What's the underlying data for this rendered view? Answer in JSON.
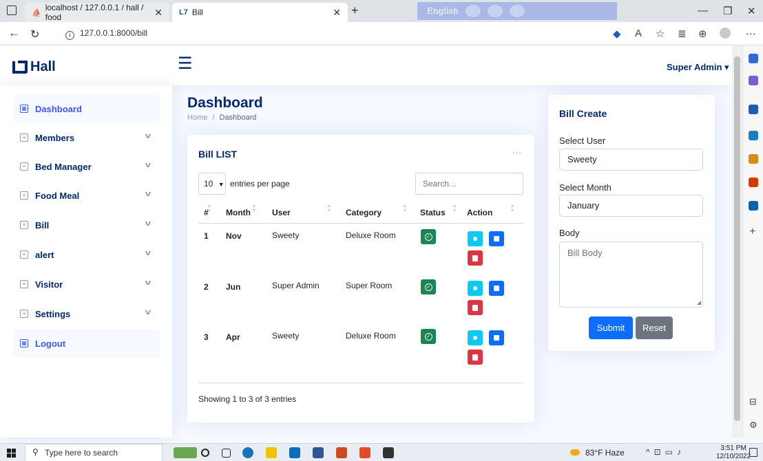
{
  "browser": {
    "tabs": [
      {
        "title": "localhost / 127.0.0.1 / hall / food"
      },
      {
        "title": "Bill"
      }
    ],
    "translate_language": "English",
    "url": "127.0.0.1:8000/bill"
  },
  "app": {
    "brand": "Hall",
    "user_menu": "Super Admin ▾"
  },
  "sidebar": {
    "items": [
      {
        "label": "Dashboard"
      },
      {
        "label": "Members"
      },
      {
        "label": "Bed Manager"
      },
      {
        "label": "Food Meal"
      },
      {
        "label": "Bill"
      },
      {
        "label": "alert"
      },
      {
        "label": "Visitor"
      },
      {
        "label": "Settings"
      },
      {
        "label": "Logout"
      }
    ]
  },
  "page": {
    "title": "Dashboard",
    "breadcrumb": [
      "Home",
      "Dashboard"
    ],
    "breadcrumb_sep": "/"
  },
  "bill_list": {
    "title": "Bill LIST",
    "more": "...",
    "entries_value": "10",
    "entries_label": "entries per page",
    "search_placeholder": "Search...",
    "columns": [
      "#",
      "Month",
      "User",
      "Category",
      "Status",
      "Action"
    ],
    "rows": [
      {
        "num": "1",
        "month": "Nov",
        "user": "Sweety",
        "category": "Deluxe Room"
      },
      {
        "num": "2",
        "month": "Jun",
        "user": "Super Admin",
        "category": "Super Room"
      },
      {
        "num": "3",
        "month": "Apr",
        "user": "Sweety",
        "category": "Deluxe Room"
      }
    ],
    "footer": "Showing 1 to 3 of 3 entries"
  },
  "bill_create": {
    "title": "Bill Create",
    "select_user_label": "Select User",
    "select_user_value": "Sweety",
    "select_month_label": "Select Month",
    "select_month_value": "January",
    "body_label": "Body",
    "body_placeholder": "Bill Body",
    "submit_label": "Submit",
    "reset_label": "Reset"
  },
  "taskbar": {
    "search_placeholder": "Type here to search",
    "weather": "83°F  Haze",
    "time": "3:51 PM",
    "date": "12/10/2022"
  },
  "colors": {
    "primary": "#0d6efd",
    "info": "#0dcaf0",
    "success": "#198754",
    "danger": "#dc3545",
    "secondary": "#6c757d",
    "brand_navy": "#012970",
    "sidebar_active": "#4154f1"
  }
}
